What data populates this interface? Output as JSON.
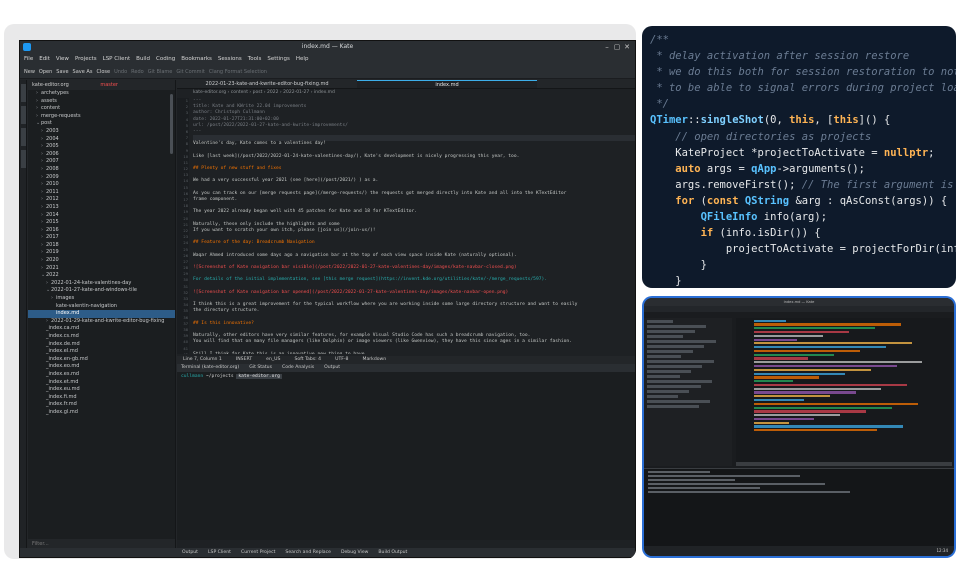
{
  "window": {
    "title": "index.md — Kate",
    "close_glyph": "✕",
    "max_glyph": "▢",
    "min_glyph": "–"
  },
  "menu": [
    "File",
    "Edit",
    "View",
    "Projects",
    "LSP Client",
    "Build",
    "Coding",
    "Bookmarks",
    "Sessions",
    "Tools",
    "Settings",
    "Help"
  ],
  "toolbar": {
    "new": "New",
    "open": "Open",
    "save": "Save",
    "save_as": "Save As",
    "close": "Close",
    "undo": "Undo",
    "redo": "Redo",
    "git_blame": "Git Blame",
    "git_commit": "Git Commit",
    "clang_format": "Clang Format Selection"
  },
  "sidebar": {
    "header": "kate-editor.org",
    "branch": "master",
    "filter_placeholder": "Filter...",
    "items": [
      {
        "label": "archetypes",
        "depth": 1,
        "twisty": "›"
      },
      {
        "label": "assets",
        "depth": 1,
        "twisty": "›"
      },
      {
        "label": "content",
        "depth": 1,
        "twisty": "›"
      },
      {
        "label": "merge-requests",
        "depth": 1,
        "twisty": "›"
      },
      {
        "label": "post",
        "depth": 1,
        "twisty": "⌄"
      },
      {
        "label": "2003",
        "depth": 2,
        "twisty": "›"
      },
      {
        "label": "2004",
        "depth": 2,
        "twisty": "›"
      },
      {
        "label": "2005",
        "depth": 2,
        "twisty": "›"
      },
      {
        "label": "2006",
        "depth": 2,
        "twisty": "›"
      },
      {
        "label": "2007",
        "depth": 2,
        "twisty": "›"
      },
      {
        "label": "2008",
        "depth": 2,
        "twisty": "›"
      },
      {
        "label": "2009",
        "depth": 2,
        "twisty": "›"
      },
      {
        "label": "2010",
        "depth": 2,
        "twisty": "›"
      },
      {
        "label": "2011",
        "depth": 2,
        "twisty": "›"
      },
      {
        "label": "2012",
        "depth": 2,
        "twisty": "›"
      },
      {
        "label": "2013",
        "depth": 2,
        "twisty": "›"
      },
      {
        "label": "2014",
        "depth": 2,
        "twisty": "›"
      },
      {
        "label": "2015",
        "depth": 2,
        "twisty": "›"
      },
      {
        "label": "2016",
        "depth": 2,
        "twisty": "›"
      },
      {
        "label": "2017",
        "depth": 2,
        "twisty": "›"
      },
      {
        "label": "2018",
        "depth": 2,
        "twisty": "›"
      },
      {
        "label": "2019",
        "depth": 2,
        "twisty": "›"
      },
      {
        "label": "2020",
        "depth": 2,
        "twisty": "›"
      },
      {
        "label": "2021",
        "depth": 2,
        "twisty": "›"
      },
      {
        "label": "2022",
        "depth": 2,
        "twisty": "⌄"
      },
      {
        "label": "2022-01-24-kate-valentines-day",
        "depth": 3,
        "twisty": "›"
      },
      {
        "label": "2022-01-27-kate-and-windows-tile",
        "depth": 3,
        "twisty": "⌄"
      },
      {
        "label": "images",
        "depth": 4,
        "twisty": "›"
      },
      {
        "label": "kate-valentin-navigation",
        "depth": 4,
        "twisty": ""
      },
      {
        "label": "index.md",
        "depth": 4,
        "twisty": "",
        "selected": true
      },
      {
        "label": "2022-01-29-kate-and-kwrite-editor-bug-fixing",
        "depth": 3,
        "twisty": "›"
      },
      {
        "label": "_index.ca.md",
        "depth": 2,
        "twisty": ""
      },
      {
        "label": "_index.cs.md",
        "depth": 2,
        "twisty": ""
      },
      {
        "label": "_index.de.md",
        "depth": 2,
        "twisty": ""
      },
      {
        "label": "_index.el.md",
        "depth": 2,
        "twisty": ""
      },
      {
        "label": "_index.en-gb.md",
        "depth": 2,
        "twisty": ""
      },
      {
        "label": "_index.eo.md",
        "depth": 2,
        "twisty": ""
      },
      {
        "label": "_index.es.md",
        "depth": 2,
        "twisty": ""
      },
      {
        "label": "_index.et.md",
        "depth": 2,
        "twisty": ""
      },
      {
        "label": "_index.eu.md",
        "depth": 2,
        "twisty": ""
      },
      {
        "label": "_index.fi.md",
        "depth": 2,
        "twisty": ""
      },
      {
        "label": "_index.fr.md",
        "depth": 2,
        "twisty": ""
      },
      {
        "label": "_index.gl.md",
        "depth": 2,
        "twisty": ""
      }
    ]
  },
  "editor": {
    "tabs": [
      "2022-01-23-kate-and-kwrite-editor-bug-fixing.md",
      "index.md"
    ],
    "breadcrumb": "kate-editor.org › content › post › 2022 › 2022-01-27 › index.md",
    "lines": [
      {
        "t": "---",
        "k": "com"
      },
      {
        "t": "title: Kate and KWrite 22.04 improvements",
        "k": "com"
      },
      {
        "t": "author: Christoph Cullmann",
        "k": "com"
      },
      {
        "t": "date: 2022-01-27T21:31:00+02:00",
        "k": "com"
      },
      {
        "t": "url: /post/2022/2022-01-27-kate-and-kwrite-improvements/",
        "k": "com"
      },
      {
        "t": "---",
        "k": "com"
      },
      {
        "t": "",
        "k": "hl"
      },
      {
        "t": "Valentine's day, Kate comes to a valentines day!",
        "k": ""
      },
      {
        "t": "",
        "k": ""
      },
      {
        "t": "Like [last week](/post/2022/2022-01-24-kate-valentines-day/), Kate's development is nicely progressing this year, too.",
        "k": ""
      },
      {
        "t": "",
        "k": ""
      },
      {
        "t": "## Plenty of new stuff and fixes",
        "k": "head"
      },
      {
        "t": "",
        "k": ""
      },
      {
        "t": "We had a very successful year 2021 (see [here](/post/2021/) ) as a.",
        "k": ""
      },
      {
        "t": "",
        "k": ""
      },
      {
        "t": "As you can track on our [merge requests page](/merge-requests/) the requests got merged directly into Kate and all into the KTextEditor",
        "k": ""
      },
      {
        "t": "frame component.",
        "k": ""
      },
      {
        "t": "",
        "k": ""
      },
      {
        "t": "The year 2022 already began well with 45 patches for Kate and 18 for KTextEditor.",
        "k": ""
      },
      {
        "t": "",
        "k": ""
      },
      {
        "t": "Naturally, these only include the highlights and some",
        "k": ""
      },
      {
        "t": "If you want to scratch your own itch, please [join us](/join-us/)!",
        "k": ""
      },
      {
        "t": "",
        "k": ""
      },
      {
        "t": "## Feature of the day: Breadcrumb Navigation",
        "k": "head"
      },
      {
        "t": "",
        "k": ""
      },
      {
        "t": "Waqar Ahmed introduced some days ago a navigation bar at the top of each view space inside Kate (naturally optional).",
        "k": ""
      },
      {
        "t": "",
        "k": ""
      },
      {
        "t": "![Screenshot of Kate navigation bar visible](/post/2022/2022-01-27-kate-valentines-day/images/kate-navbar-closed.png)",
        "k": "img"
      },
      {
        "t": "",
        "k": ""
      },
      {
        "t": "For details of the initial implementation, see [this merge request](https://invent.kde.org/utilities/kate/-/merge_requests/597).",
        "k": "link"
      },
      {
        "t": "",
        "k": ""
      },
      {
        "t": "![Screenshot of Kate navigation bar opened](/post/2022/2022-01-27-kate-valentines-day/images/kate-navbar-open.png)",
        "k": "img"
      },
      {
        "t": "",
        "k": ""
      },
      {
        "t": "I think this is a great improvement for the typical workflow where you are working inside some large directory structure and want to easily",
        "k": ""
      },
      {
        "t": "the directory structure.",
        "k": ""
      },
      {
        "t": "",
        "k": ""
      },
      {
        "t": "## Is this innovative?",
        "k": "head"
      },
      {
        "t": "",
        "k": ""
      },
      {
        "t": "Naturally, other editors have very similar features, for example Visual Studio Code has such a breadcrumb navigation, too.",
        "k": ""
      },
      {
        "t": "You will find that on many file managers (like Dolphin) or image viewers (like Gwenview), they have this since ages in a similar fashion.",
        "k": ""
      },
      {
        "t": "",
        "k": ""
      },
      {
        "t": "Still I think for Kate this is an innovative new thing to have.",
        "k": ""
      },
      {
        "t": "And for sure a lot of people will like it and love to use it.",
        "k": ""
      },
      {
        "t": "",
        "k": ""
      },
      {
        "t": "Therefore, if you read somewhere the time of innovation is over for KDE projects, I object.",
        "k": ""
      },
      {
        "t": "Yes they I believe in large revolutionary jumps, I have not seen this so far in real life, but I believe we still strive to improve our",
        "k": ""
      },
      {
        "t": "projects in an innovative fashion.",
        "k": ""
      },
      {
        "t": "And often this means incremental improvements and converging into directions already explored in others.",
        "k": ""
      }
    ],
    "status": {
      "position": "Line 7, Column 1",
      "mode": "INSERT",
      "lang": "en_US",
      "indent": "Soft Tabs: 4",
      "encoding": "UTF-8",
      "syntax": "Markdown"
    },
    "terminal_tabs": [
      "Terminal (kate-editor.org)",
      "Git Status",
      "Code Analysis",
      "Output"
    ],
    "terminal": {
      "user": "cullmann",
      "path": "~/projects",
      "branch": "kate-editor.org",
      "cmd": ""
    },
    "bottom_tabs": [
      "Output",
      "LSP Client",
      "Current Project",
      "Search and Replace",
      "Debug View",
      "Build Output"
    ]
  },
  "code_card": {
    "lines": [
      [
        {
          "t": "/**",
          "c": "com"
        }
      ],
      [
        {
          "t": " * delay activation after session restore",
          "c": "com"
        }
      ],
      [
        {
          "t": " * we do this both for session restoration to not take",
          "c": "com"
        }
      ],
      [
        {
          "t": " * to be able to signal errors during project loading v",
          "c": "com"
        }
      ],
      [
        {
          "t": " */",
          "c": "com"
        }
      ],
      [
        {
          "t": "QTimer",
          "c": "type"
        },
        {
          "t": "::",
          "c": "op"
        },
        {
          "t": "singleShot",
          "c": "fn"
        },
        {
          "t": "(0, ",
          "c": "op"
        },
        {
          "t": "this",
          "c": "kw"
        },
        {
          "t": ", [",
          "c": "op"
        },
        {
          "t": "this",
          "c": "kw"
        },
        {
          "t": "]() {",
          "c": "op"
        }
      ],
      [
        {
          "t": "    // open directories as projects",
          "c": "com"
        }
      ],
      [
        {
          "t": "    KateProject *projectToActivate = ",
          "c": "op"
        },
        {
          "t": "nullptr",
          "c": "null"
        },
        {
          "t": ";",
          "c": "op"
        }
      ],
      [
        {
          "t": "    ",
          "c": "op"
        },
        {
          "t": "auto",
          "c": "kw"
        },
        {
          "t": " args = ",
          "c": "op"
        },
        {
          "t": "qApp",
          "c": "type"
        },
        {
          "t": "->arguments();",
          "c": "op"
        }
      ],
      [
        {
          "t": "    args.removeFirst(); ",
          "c": "op"
        },
        {
          "t": "// The first argument is the e",
          "c": "com"
        }
      ],
      [
        {
          "t": "    ",
          "c": "op"
        },
        {
          "t": "for",
          "c": "kw"
        },
        {
          "t": " (",
          "c": "op"
        },
        {
          "t": "const",
          "c": "kw"
        },
        {
          "t": " ",
          "c": "op"
        },
        {
          "t": "QString",
          "c": "type"
        },
        {
          "t": " &arg : qAsConst(args)) {",
          "c": "op"
        }
      ],
      [
        {
          "t": "        ",
          "c": "op"
        },
        {
          "t": "QFileInfo",
          "c": "type"
        },
        {
          "t": " info(arg);",
          "c": "op"
        }
      ],
      [
        {
          "t": "        ",
          "c": "op"
        },
        {
          "t": "if",
          "c": "kw"
        },
        {
          "t": " (info.isDir()) {",
          "c": "op"
        }
      ],
      [
        {
          "t": "            projectToActivate = projectForDir(info.abs",
          "c": "op"
        }
      ],
      [
        {
          "t": "        }",
          "c": "op"
        }
      ],
      [
        {
          "t": "    }",
          "c": "op"
        }
      ]
    ]
  },
  "shot_card": {
    "title": "index.md — Kate",
    "clock": "12:34"
  }
}
